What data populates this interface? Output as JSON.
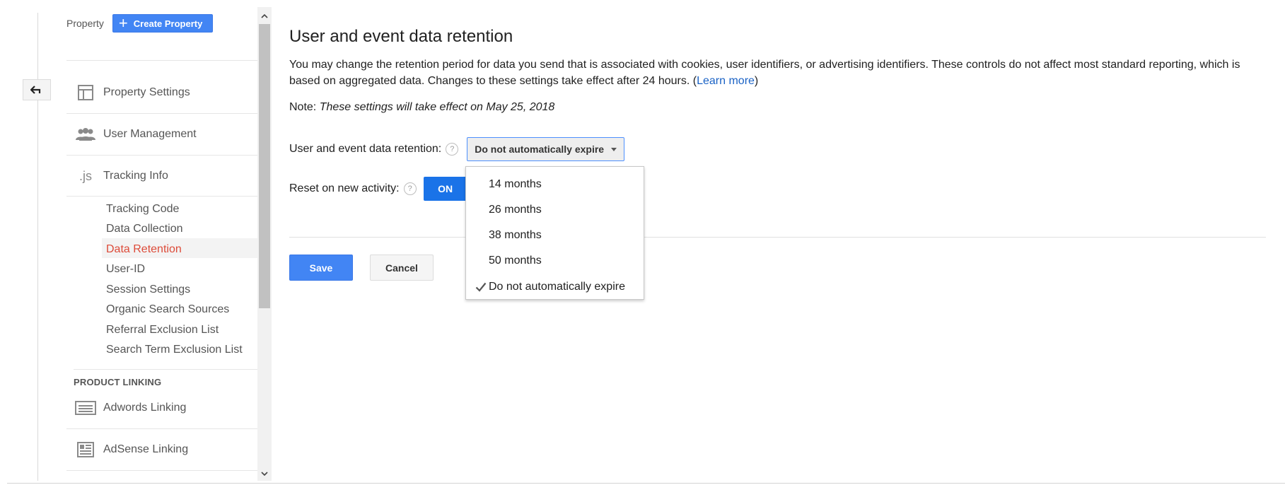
{
  "sidebar": {
    "property_label": "Property",
    "create_button": "Create Property",
    "items": [
      {
        "label": "Property Settings",
        "icon": "layout-icon"
      },
      {
        "label": "User Management",
        "icon": "users-icon"
      },
      {
        "label": "Tracking Info",
        "icon": "js-icon",
        "icon_text": ".js"
      }
    ],
    "sub_items": [
      "Tracking Code",
      "Data Collection",
      "Data Retention",
      "User-ID",
      "Session Settings",
      "Organic Search Sources",
      "Referral Exclusion List",
      "Search Term Exclusion List"
    ],
    "active_sub_item": "Data Retention",
    "section_title": "PRODUCT LINKING",
    "linking_items": [
      {
        "label": "Adwords Linking",
        "icon": "adwords-icon"
      },
      {
        "label": "AdSense Linking",
        "icon": "adsense-icon"
      }
    ]
  },
  "main": {
    "title": "User and event data retention",
    "description": "You may change the retention period for data you send that is associated with cookies, user identifiers, or advertising identifiers. These controls do not affect most standard reporting, which is based on aggregated data. Changes to these settings take effect after 24 hours. (",
    "learn_more": "Learn more",
    "description_end": ")",
    "note_label": "Note: ",
    "note_text": "These settings will take effect on May 25, 2018",
    "retention_label": "User and event data retention:",
    "retention_value": "Do not automatically expire",
    "reset_label": "Reset on new activity:",
    "reset_value": "ON",
    "save_button": "Save",
    "cancel_button": "Cancel"
  },
  "dropdown": {
    "options": [
      "14 months",
      "26 months",
      "38 months",
      "50 months",
      "Do not automatically expire"
    ],
    "selected": "Do not automatically expire"
  },
  "colors": {
    "accent_blue": "#4285f4",
    "toggle_blue": "#1a73e8",
    "active_red": "#dd4b39",
    "link_blue": "#1a62c5"
  }
}
